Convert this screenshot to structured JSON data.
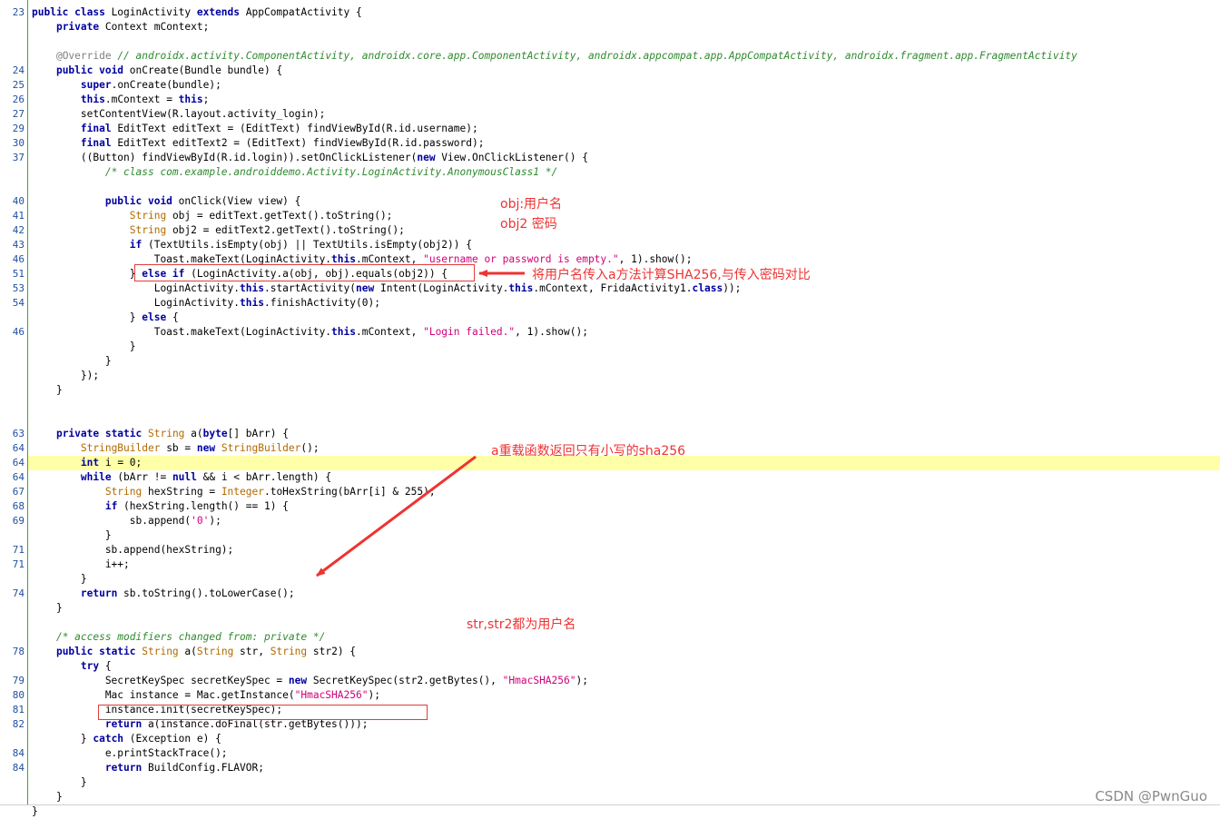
{
  "editor": {
    "lines": [
      {
        "num": "23",
        "spans": [
          [
            "public class ",
            "kw"
          ],
          [
            "LoginActivity ",
            ""
          ],
          [
            "extends ",
            "kw"
          ],
          [
            "AppCompatActivity {",
            ""
          ]
        ]
      },
      {
        "num": "",
        "spans": [
          [
            "    ",
            ""
          ],
          [
            "private ",
            "kw"
          ],
          [
            "Context mContext;",
            ""
          ]
        ]
      },
      {
        "num": "",
        "spans": []
      },
      {
        "num": "",
        "spans": [
          [
            "    ",
            ""
          ],
          [
            "@Override ",
            "an"
          ],
          [
            "// androidx.activity.ComponentActivity, androidx.core.app.ComponentActivity, androidx.appcompat.app.AppCompatActivity, androidx.fragment.app.FragmentActivity",
            "cm"
          ]
        ]
      },
      {
        "num": "24",
        "spans": [
          [
            "    ",
            ""
          ],
          [
            "public void ",
            "kw"
          ],
          [
            "onCreate(Bundle bundle) {",
            ""
          ]
        ]
      },
      {
        "num": "25",
        "spans": [
          [
            "        ",
            ""
          ],
          [
            "super",
            "kw"
          ],
          [
            ".onCreate(bundle);",
            ""
          ]
        ]
      },
      {
        "num": "26",
        "spans": [
          [
            "        ",
            ""
          ],
          [
            "this",
            "kw"
          ],
          [
            ".mContext = ",
            ""
          ],
          [
            "this",
            "kw"
          ],
          [
            ";",
            ""
          ]
        ]
      },
      {
        "num": "27",
        "spans": [
          [
            "        setContentView(R.layout.activity_login);",
            ""
          ]
        ]
      },
      {
        "num": "29",
        "spans": [
          [
            "        ",
            ""
          ],
          [
            "final ",
            "kw"
          ],
          [
            "EditText editText = (EditText) findViewById(R.id.username);",
            ""
          ]
        ]
      },
      {
        "num": "30",
        "spans": [
          [
            "        ",
            ""
          ],
          [
            "final ",
            "kw"
          ],
          [
            "EditText editText2 = (EditText) findViewById(R.id.password);",
            ""
          ]
        ]
      },
      {
        "num": "37",
        "spans": [
          [
            "        ((Button) findViewById(R.id.login)).setOnClickListener(",
            ""
          ],
          [
            "new ",
            "kw"
          ],
          [
            "View.OnClickListener() {",
            ""
          ]
        ]
      },
      {
        "num": "",
        "spans": [
          [
            "            ",
            ""
          ],
          [
            "/* class com.example.androiddemo.Activity.LoginActivity.AnonymousClass1 */",
            "cm"
          ]
        ]
      },
      {
        "num": "",
        "spans": []
      },
      {
        "num": "40",
        "spans": [
          [
            "            ",
            ""
          ],
          [
            "public void ",
            "kw"
          ],
          [
            "onClick(View view) {",
            ""
          ]
        ]
      },
      {
        "num": "41",
        "spans": [
          [
            "                ",
            ""
          ],
          [
            "String ",
            "ty"
          ],
          [
            "obj = editText.getText().toString();",
            ""
          ]
        ]
      },
      {
        "num": "42",
        "spans": [
          [
            "                ",
            ""
          ],
          [
            "String ",
            "ty"
          ],
          [
            "obj2 = editText2.getText().toString();",
            ""
          ]
        ]
      },
      {
        "num": "43",
        "spans": [
          [
            "                ",
            ""
          ],
          [
            "if ",
            "kw"
          ],
          [
            "(TextUtils.isEmpty(obj) || TextUtils.isEmpty(obj2)) {",
            ""
          ]
        ]
      },
      {
        "num": "46",
        "spans": [
          [
            "                    Toast.makeText(LoginActivity.",
            ""
          ],
          [
            "this",
            "kw"
          ],
          [
            ".mContext, ",
            ""
          ],
          [
            "\"username or password is empty.\"",
            "str"
          ],
          [
            ", 1).show();",
            ""
          ]
        ]
      },
      {
        "num": "51",
        "spans": [
          [
            "                } ",
            ""
          ],
          [
            "else if ",
            "kw"
          ],
          [
            "(LoginActivity.a(obj, obj).equals(obj2)) {",
            ""
          ]
        ]
      },
      {
        "num": "53",
        "spans": [
          [
            "                    LoginActivity.",
            ""
          ],
          [
            "this",
            "kw"
          ],
          [
            ".startActivity(",
            ""
          ],
          [
            "new ",
            "kw"
          ],
          [
            "Intent(LoginActivity.",
            ""
          ],
          [
            "this",
            "kw"
          ],
          [
            ".mContext, FridaActivity1.",
            ""
          ],
          [
            "class",
            "kw"
          ],
          [
            "));",
            ""
          ]
        ]
      },
      {
        "num": "54",
        "spans": [
          [
            "                    LoginActivity.",
            ""
          ],
          [
            "this",
            "kw"
          ],
          [
            ".finishActivity(0);",
            ""
          ]
        ]
      },
      {
        "num": "",
        "spans": [
          [
            "                } ",
            ""
          ],
          [
            "else ",
            "kw"
          ],
          [
            "{",
            ""
          ]
        ]
      },
      {
        "num": "46",
        "spans": [
          [
            "                    Toast.makeText(LoginActivity.",
            ""
          ],
          [
            "this",
            "kw"
          ],
          [
            ".mContext, ",
            ""
          ],
          [
            "\"Login failed.\"",
            "str"
          ],
          [
            ", 1).show();",
            ""
          ]
        ]
      },
      {
        "num": "",
        "spans": [
          [
            "                }",
            ""
          ]
        ]
      },
      {
        "num": "",
        "spans": [
          [
            "            }",
            ""
          ]
        ]
      },
      {
        "num": "",
        "spans": [
          [
            "        });",
            ""
          ]
        ]
      },
      {
        "num": "",
        "spans": [
          [
            "    }",
            ""
          ]
        ]
      },
      {
        "num": "",
        "spans": []
      },
      {
        "num": "",
        "spans": []
      },
      {
        "num": "63",
        "spans": [
          [
            "    ",
            ""
          ],
          [
            "private static ",
            "kw"
          ],
          [
            "String ",
            "ty"
          ],
          [
            "a(",
            ""
          ],
          [
            "byte",
            "kw"
          ],
          [
            "[] bArr) {",
            ""
          ]
        ]
      },
      {
        "num": "64",
        "spans": [
          [
            "        ",
            ""
          ],
          [
            "StringBuilder ",
            "ty"
          ],
          [
            "sb = ",
            ""
          ],
          [
            "new ",
            "kw"
          ],
          [
            "StringBuilder",
            "ty"
          ],
          [
            "();",
            ""
          ]
        ]
      },
      {
        "num": "64",
        "hl": true,
        "spans": [
          [
            "        ",
            ""
          ],
          [
            "int ",
            "kw"
          ],
          [
            "i = 0;",
            ""
          ]
        ]
      },
      {
        "num": "64",
        "spans": [
          [
            "        ",
            ""
          ],
          [
            "while ",
            "kw"
          ],
          [
            "(bArr != ",
            ""
          ],
          [
            "null ",
            "kw"
          ],
          [
            "&& i < bArr.length) {",
            ""
          ]
        ]
      },
      {
        "num": "67",
        "spans": [
          [
            "            ",
            ""
          ],
          [
            "String ",
            "ty"
          ],
          [
            "hexString = ",
            ""
          ],
          [
            "Integer",
            "ty"
          ],
          [
            ".toHexString(bArr[i] & 255);",
            ""
          ]
        ]
      },
      {
        "num": "68",
        "spans": [
          [
            "            ",
            ""
          ],
          [
            "if ",
            "kw"
          ],
          [
            "(hexString.length() == 1) {",
            ""
          ]
        ]
      },
      {
        "num": "69",
        "spans": [
          [
            "                sb.append(",
            ""
          ],
          [
            "'0'",
            "str"
          ],
          [
            ");",
            ""
          ]
        ]
      },
      {
        "num": "",
        "spans": [
          [
            "            }",
            ""
          ]
        ]
      },
      {
        "num": "71",
        "spans": [
          [
            "            sb.append(hexString);",
            ""
          ]
        ]
      },
      {
        "num": "71",
        "spans": [
          [
            "            i++;",
            ""
          ]
        ]
      },
      {
        "num": "",
        "spans": [
          [
            "        }",
            ""
          ]
        ]
      },
      {
        "num": "74",
        "spans": [
          [
            "        ",
            ""
          ],
          [
            "return ",
            "kw"
          ],
          [
            "sb.toString().toLowerCase();",
            ""
          ]
        ]
      },
      {
        "num": "",
        "spans": [
          [
            "    }",
            ""
          ]
        ]
      },
      {
        "num": "",
        "spans": []
      },
      {
        "num": "",
        "spans": [
          [
            "    ",
            ""
          ],
          [
            "/* access modifiers changed from: private */",
            "cm"
          ]
        ]
      },
      {
        "num": "78",
        "spans": [
          [
            "    ",
            ""
          ],
          [
            "public static ",
            "kw"
          ],
          [
            "String ",
            "ty"
          ],
          [
            "a(",
            ""
          ],
          [
            "String ",
            "ty"
          ],
          [
            "str, ",
            ""
          ],
          [
            "String ",
            "ty"
          ],
          [
            "str2) {",
            ""
          ]
        ]
      },
      {
        "num": "",
        "spans": [
          [
            "        ",
            ""
          ],
          [
            "try ",
            "kw"
          ],
          [
            "{",
            ""
          ]
        ]
      },
      {
        "num": "79",
        "spans": [
          [
            "            SecretKeySpec secretKeySpec = ",
            ""
          ],
          [
            "new ",
            "kw"
          ],
          [
            "SecretKeySpec(str2.getBytes(), ",
            ""
          ],
          [
            "\"HmacSHA256\"",
            "str"
          ],
          [
            ");",
            ""
          ]
        ]
      },
      {
        "num": "80",
        "spans": [
          [
            "            Mac instance = Mac.getInstance(",
            ""
          ],
          [
            "\"HmacSHA256\"",
            "str"
          ],
          [
            ");",
            ""
          ]
        ]
      },
      {
        "num": "81",
        "spans": [
          [
            "            instance.init(secretKeySpec);",
            ""
          ]
        ]
      },
      {
        "num": "82",
        "spans": [
          [
            "            ",
            ""
          ],
          [
            "return ",
            "kw"
          ],
          [
            "a(instance.doFinal(str.getBytes()));",
            ""
          ]
        ]
      },
      {
        "num": "",
        "spans": [
          [
            "        } ",
            ""
          ],
          [
            "catch ",
            "kw"
          ],
          [
            "(Exception e) {",
            ""
          ]
        ]
      },
      {
        "num": "84",
        "spans": [
          [
            "            e.printStackTrace();",
            ""
          ]
        ]
      },
      {
        "num": "84",
        "spans": [
          [
            "            ",
            ""
          ],
          [
            "return ",
            "kw"
          ],
          [
            "BuildConfig.FLAVOR;",
            ""
          ]
        ]
      },
      {
        "num": "",
        "spans": [
          [
            "        }",
            ""
          ]
        ]
      },
      {
        "num": "",
        "spans": [
          [
            "    }",
            ""
          ]
        ]
      },
      {
        "num": "",
        "spans": [
          [
            "}",
            ""
          ]
        ]
      }
    ]
  },
  "annotations": {
    "obj_label": "obj:用户名",
    "obj2_label": "obj2 密码",
    "sha_compare": "将用户名传入a方法计算SHA256,与传入密码对比",
    "lowercase_note": "a重载函数返回只有小写的sha256",
    "str_note": "str,str2都为用户名"
  },
  "colors": {
    "annotation": "#ee3333",
    "gutter_border": "#3fa33f",
    "highlight": "#ffffa8"
  },
  "watermark": "CSDN @PwnGuo"
}
